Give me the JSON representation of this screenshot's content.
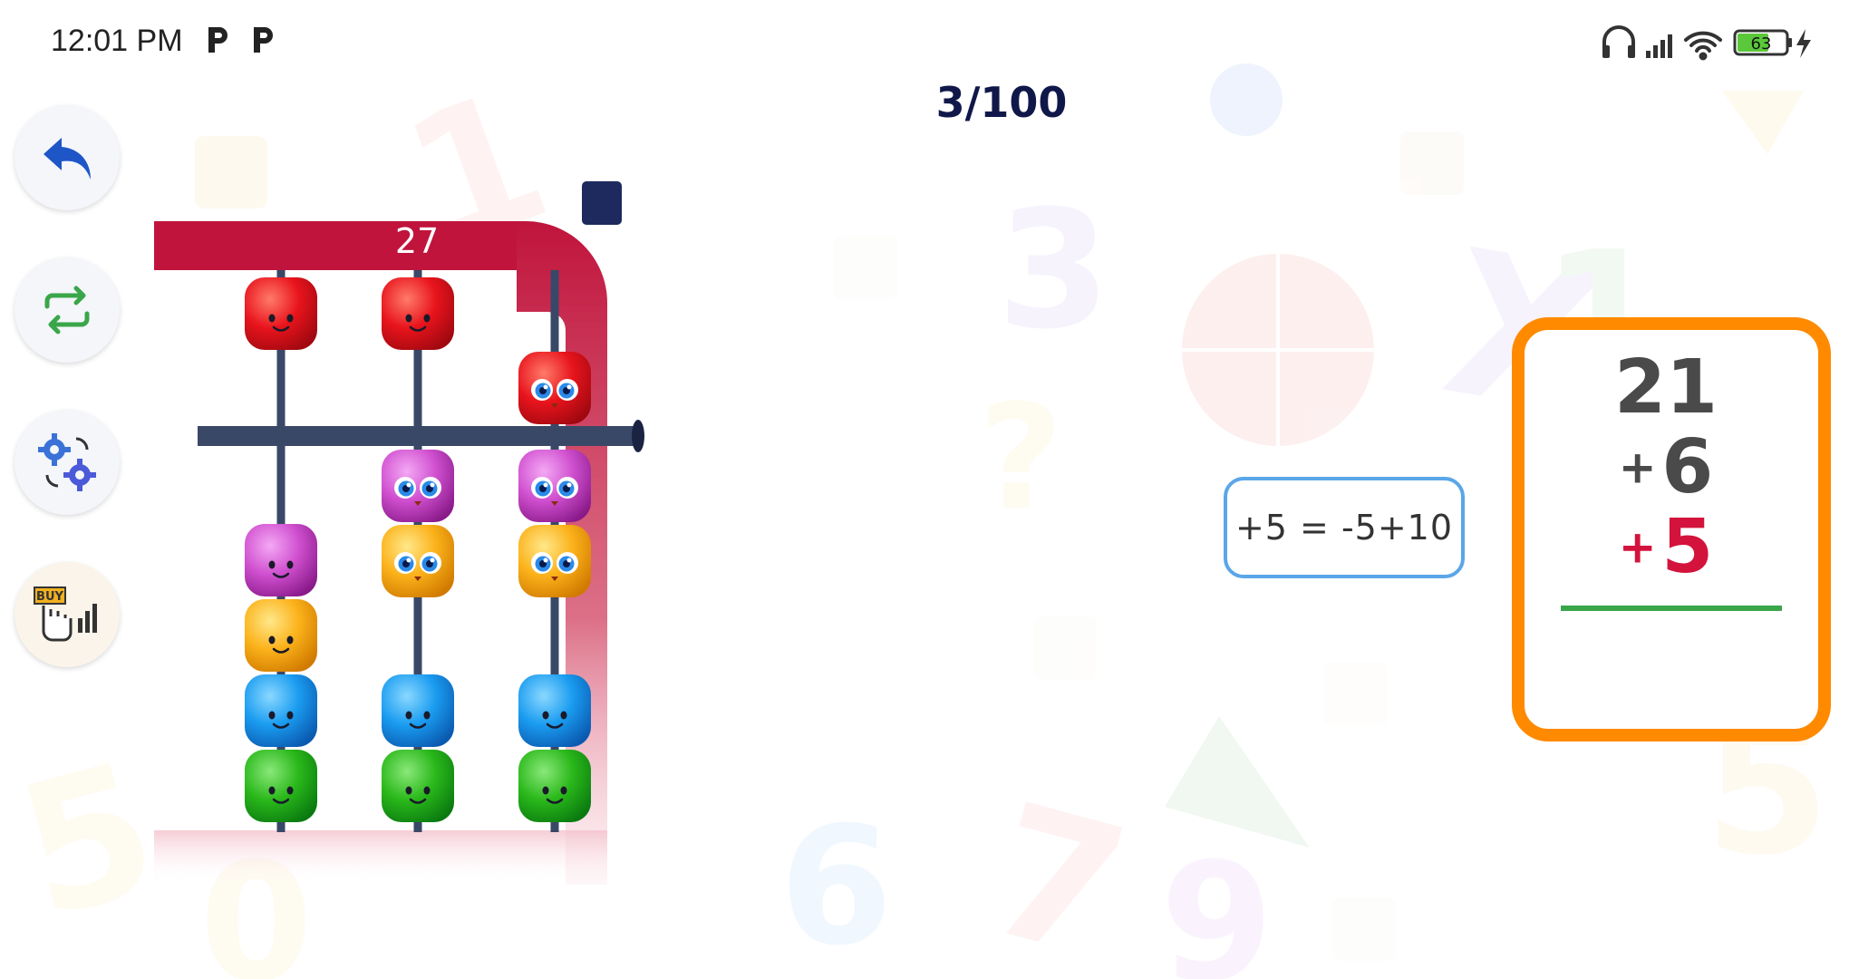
{
  "status_bar": {
    "time": "12:01 PM",
    "battery": "63"
  },
  "progress": "3/100",
  "abacus": {
    "total": "27",
    "rods": [
      {
        "place": "tens",
        "upper_bead_active": false,
        "lower_beads_active": 2
      },
      {
        "place": "ones",
        "upper_bead_active": false,
        "lower_beads_active": 3
      },
      {
        "place": "units",
        "upper_bead_active": true,
        "lower_beads_active": 2
      }
    ]
  },
  "hint": "+5 = -5+10",
  "problem": {
    "first": "21",
    "second_op": "+",
    "second": "6",
    "third_op": "+",
    "third": "5"
  },
  "side_buttons": {
    "back": "undo-arrow-icon",
    "swap": "swap-arrows-icon",
    "settings": "gears-icon",
    "buy": "buy-icon"
  },
  "colors": {
    "frame_red": "#c0143c",
    "card_border": "#ff8a00",
    "answer_line": "#3aa64a",
    "highlight_num": "#d3133c",
    "hint_border": "#5aa6e8"
  }
}
